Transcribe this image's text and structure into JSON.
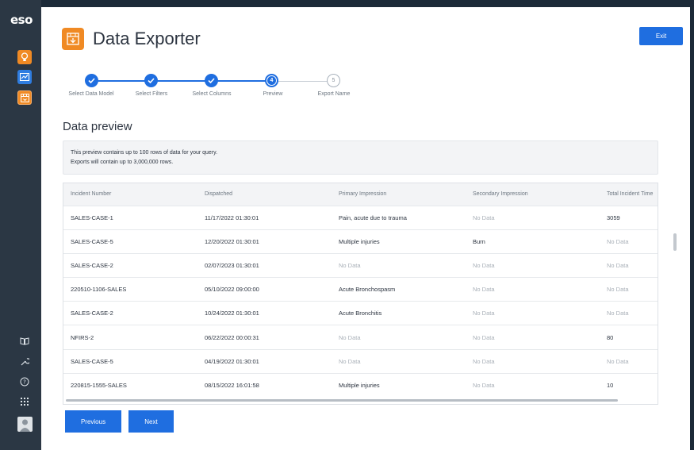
{
  "sidebar": {
    "logo": "eso",
    "top_icons": [
      "lightbulb-icon",
      "chart-icon",
      "exporter-icon"
    ],
    "bottom_icons": [
      "book-icon",
      "wrench-icon",
      "help-icon",
      "apps-grid-icon"
    ],
    "colors": {
      "orange": "#f08a24",
      "blue": "#1f6ee0",
      "background": "#2b3744"
    }
  },
  "header": {
    "title": "Data Exporter",
    "exit_label": "Exit"
  },
  "stepper": {
    "steps": [
      {
        "label": "Select Data Model",
        "state": "done"
      },
      {
        "label": "Select Filters",
        "state": "done"
      },
      {
        "label": "Select Columns",
        "state": "done"
      },
      {
        "label": "Preview",
        "state": "current",
        "number": "4"
      },
      {
        "label": "Export Name",
        "state": "future",
        "number": "5"
      }
    ]
  },
  "preview": {
    "title": "Data preview",
    "info_line1": "This preview contains up to 100 rows of data for your query.",
    "info_line2": "Exports will contain up to 3,000,000 rows."
  },
  "table": {
    "columns": [
      "Incident Number",
      "Dispatched",
      "Primary Impression",
      "Secondary Impression",
      "Total Incident Time"
    ],
    "rows": [
      [
        "SALES-CASE-1",
        "11/17/2022 01:30:01",
        "Pain, acute due to trauma",
        "No Data",
        "3059"
      ],
      [
        "SALES-CASE-5",
        "12/20/2022 01:30:01",
        "Multiple injuries",
        "Burn",
        "No Data"
      ],
      [
        "SALES-CASE-2",
        "02/07/2023 01:30:01",
        "No Data",
        "No Data",
        "No Data"
      ],
      [
        "220510-1106-SALES",
        "05/10/2022 09:00:00",
        "Acute Bronchospasm",
        "No Data",
        "No Data"
      ],
      [
        "SALES-CASE-2",
        "10/24/2022 01:30:01",
        "Acute Bronchitis",
        "No Data",
        "No Data"
      ],
      [
        "NFIRS-2",
        "06/22/2022 00:00:31",
        "No Data",
        "No Data",
        "80"
      ],
      [
        "SALES-CASE-5",
        "04/19/2022 01:30:01",
        "No Data",
        "No Data",
        "No Data"
      ],
      [
        "220815-1555-SALES",
        "08/15/2022 16:01:58",
        "Multiple injuries",
        "No Data",
        "10"
      ]
    ]
  },
  "footer": {
    "previous_label": "Previous",
    "next_label": "Next"
  }
}
